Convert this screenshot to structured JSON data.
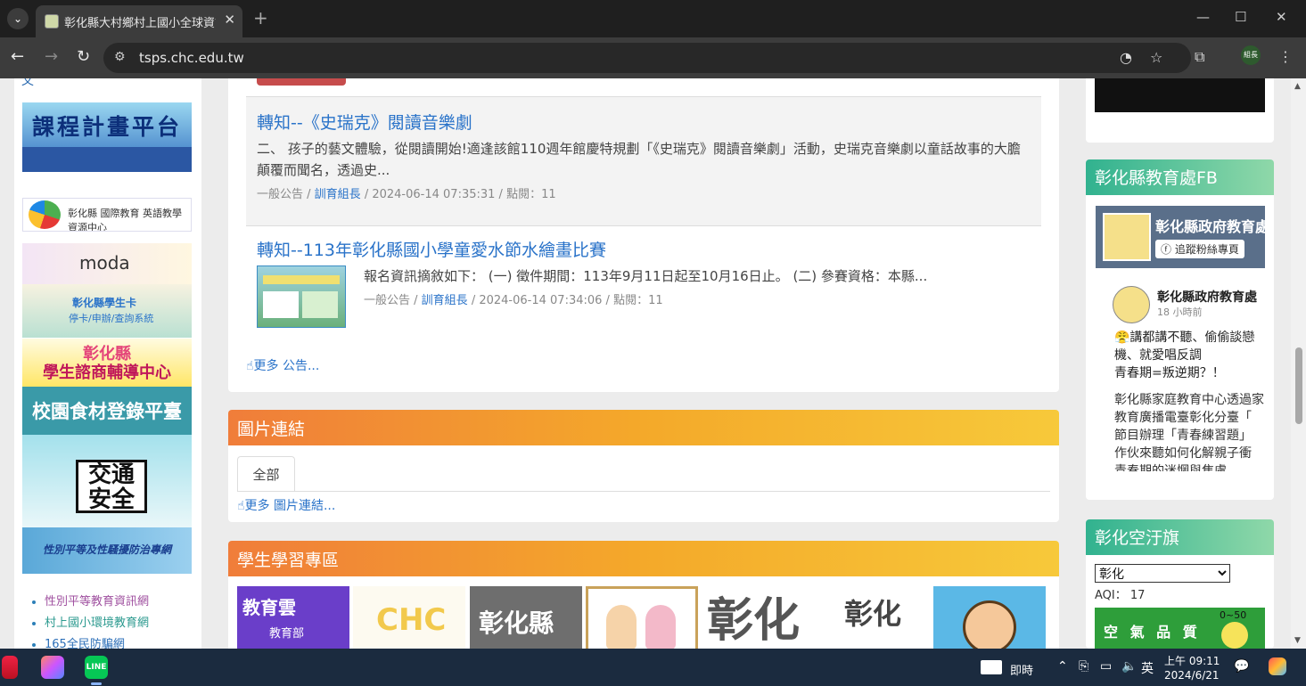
{
  "browser": {
    "tab_title": "彰化縣大村鄉村上國小全球資訊網",
    "tab_close": "✕",
    "new_tab": "+",
    "tab_menu": "⌄",
    "url": "tsps.chc.edu.tw",
    "profile_label": "組長",
    "window_controls": [
      "—",
      "☐",
      "✕"
    ],
    "icons": [
      "back-icon",
      "forward-icon",
      "reload-icon",
      "site-settings-icon",
      "performance-icon",
      "star-icon",
      "extensions-icon",
      "menu-icon"
    ]
  },
  "left_col": {
    "top_fragment": "文",
    "banners": {
      "course_title": "課程計畫平台",
      "ceetrc_text": "彰化縣 國際教育 英語教學資源中心",
      "moda_text": "moda",
      "student_card": "彰化縣學生卡",
      "student_card_sub": "停卡/申辦/查詢系統",
      "consult_title": "彰化縣",
      "consult_sub": "學生諮商輔導中心",
      "food_text": "校園食材登錄平臺",
      "traffic_text": "交通安全",
      "gender_text": "性別平等及性騷擾防治專網"
    },
    "links": [
      "性別平等教育資訊網",
      "村上國小環境教育網",
      "165全民防騙網"
    ]
  },
  "announcements": {
    "posts": [
      {
        "title": "轉知--《史瑞克》閱讀音樂劇",
        "body": "二、 孩子的藝文體驗，從閱讀開始!適逢該館110週年館慶特規劃「《史瑞克》閱讀音樂劇」活動，史瑞克音樂劇以童話故事的大膽顛覆而聞名，透過史...",
        "category": "一般公告",
        "author": "訓育組長",
        "datetime": "2024-06-14 07:35:31",
        "clicks_label": "點閱：11"
      },
      {
        "title": "轉知--113年彰化縣國小學童愛水節水繪畫比賽",
        "body": "報名資訊摘敘如下： (一) 徵件期間：113年9月11日起至10月16日止。 (二) 參賽資格：本縣...",
        "category": "一般公告",
        "author": "訓育組長",
        "datetime": "2024-06-14 07:34:06",
        "clicks_label": "點閱：11"
      }
    ],
    "more_label": "更多 公告..."
  },
  "image_links": {
    "header": "圖片連結",
    "tab_all": "全部",
    "more_label": "更多 圖片連結..."
  },
  "learning_zone": {
    "header": "學生學習專區",
    "tiles": {
      "edu_cloud": "教育雲",
      "edu_cloud_sub": "教育部",
      "chc": "CHC",
      "selflearn": "彰化縣",
      "changhua1": "彰化",
      "changhua2": "彰化"
    }
  },
  "right_col": {
    "fb_header": "彰化縣教育處FB",
    "fb_page_name": "彰化縣政府教育處",
    "fb_follow_label": "追蹤粉絲專頁",
    "fb_post_name": "彰化縣政府教育處",
    "fb_post_time": "18 小時前",
    "fb_text_lines": [
      "😤講都講不聽、偷偷談戀",
      "機、就愛唱反調",
      "青春期=叛逆期？！"
    ],
    "fb_text2_lines": [
      "彰化縣家庭教育中心透過家",
      "教育廣播電臺彰化分臺「",
      "節目辦理「青春練習題」",
      "作伙來聽如何化解親子衝",
      "青春期的迷惘與焦慮..."
    ],
    "air_header": "彰化空汙旗",
    "air_select_value": "彰化",
    "aqi_label": "AQI： 17",
    "aqi_box_text": "空 氣 品 質",
    "aqi_range": "0~50"
  },
  "taskbar": {
    "input_method_label": "即時",
    "ime_char": "英",
    "time": "上午 09:11",
    "date": "2024/6/21"
  },
  "colors": {
    "link_blue": "#2a73c9",
    "orange_header_start": "#f07d3a",
    "orange_header_end": "#f7c93a",
    "green_header_start": "#31b28f",
    "green_header_end": "#8fd8a9",
    "taskbar": "#1b2b3f"
  }
}
